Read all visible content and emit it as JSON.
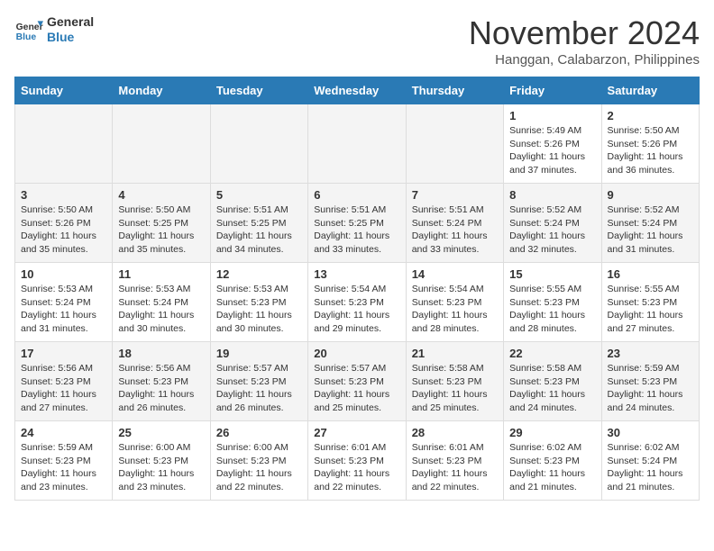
{
  "header": {
    "logo_general": "General",
    "logo_blue": "Blue",
    "month_title": "November 2024",
    "location": "Hanggan, Calabarzon, Philippines"
  },
  "weekdays": [
    "Sunday",
    "Monday",
    "Tuesday",
    "Wednesday",
    "Thursday",
    "Friday",
    "Saturday"
  ],
  "weeks": [
    [
      {
        "day": "",
        "empty": true
      },
      {
        "day": "",
        "empty": true
      },
      {
        "day": "",
        "empty": true
      },
      {
        "day": "",
        "empty": true
      },
      {
        "day": "",
        "empty": true
      },
      {
        "day": "1",
        "sunrise": "5:49 AM",
        "sunset": "5:26 PM",
        "daylight": "11 hours and 37 minutes."
      },
      {
        "day": "2",
        "sunrise": "5:50 AM",
        "sunset": "5:26 PM",
        "daylight": "11 hours and 36 minutes."
      }
    ],
    [
      {
        "day": "3",
        "sunrise": "5:50 AM",
        "sunset": "5:26 PM",
        "daylight": "11 hours and 35 minutes."
      },
      {
        "day": "4",
        "sunrise": "5:50 AM",
        "sunset": "5:25 PM",
        "daylight": "11 hours and 35 minutes."
      },
      {
        "day": "5",
        "sunrise": "5:51 AM",
        "sunset": "5:25 PM",
        "daylight": "11 hours and 34 minutes."
      },
      {
        "day": "6",
        "sunrise": "5:51 AM",
        "sunset": "5:25 PM",
        "daylight": "11 hours and 33 minutes."
      },
      {
        "day": "7",
        "sunrise": "5:51 AM",
        "sunset": "5:24 PM",
        "daylight": "11 hours and 33 minutes."
      },
      {
        "day": "8",
        "sunrise": "5:52 AM",
        "sunset": "5:24 PM",
        "daylight": "11 hours and 32 minutes."
      },
      {
        "day": "9",
        "sunrise": "5:52 AM",
        "sunset": "5:24 PM",
        "daylight": "11 hours and 31 minutes."
      }
    ],
    [
      {
        "day": "10",
        "sunrise": "5:53 AM",
        "sunset": "5:24 PM",
        "daylight": "11 hours and 31 minutes."
      },
      {
        "day": "11",
        "sunrise": "5:53 AM",
        "sunset": "5:24 PM",
        "daylight": "11 hours and 30 minutes."
      },
      {
        "day": "12",
        "sunrise": "5:53 AM",
        "sunset": "5:23 PM",
        "daylight": "11 hours and 30 minutes."
      },
      {
        "day": "13",
        "sunrise": "5:54 AM",
        "sunset": "5:23 PM",
        "daylight": "11 hours and 29 minutes."
      },
      {
        "day": "14",
        "sunrise": "5:54 AM",
        "sunset": "5:23 PM",
        "daylight": "11 hours and 28 minutes."
      },
      {
        "day": "15",
        "sunrise": "5:55 AM",
        "sunset": "5:23 PM",
        "daylight": "11 hours and 28 minutes."
      },
      {
        "day": "16",
        "sunrise": "5:55 AM",
        "sunset": "5:23 PM",
        "daylight": "11 hours and 27 minutes."
      }
    ],
    [
      {
        "day": "17",
        "sunrise": "5:56 AM",
        "sunset": "5:23 PM",
        "daylight": "11 hours and 27 minutes."
      },
      {
        "day": "18",
        "sunrise": "5:56 AM",
        "sunset": "5:23 PM",
        "daylight": "11 hours and 26 minutes."
      },
      {
        "day": "19",
        "sunrise": "5:57 AM",
        "sunset": "5:23 PM",
        "daylight": "11 hours and 26 minutes."
      },
      {
        "day": "20",
        "sunrise": "5:57 AM",
        "sunset": "5:23 PM",
        "daylight": "11 hours and 25 minutes."
      },
      {
        "day": "21",
        "sunrise": "5:58 AM",
        "sunset": "5:23 PM",
        "daylight": "11 hours and 25 minutes."
      },
      {
        "day": "22",
        "sunrise": "5:58 AM",
        "sunset": "5:23 PM",
        "daylight": "11 hours and 24 minutes."
      },
      {
        "day": "23",
        "sunrise": "5:59 AM",
        "sunset": "5:23 PM",
        "daylight": "11 hours and 24 minutes."
      }
    ],
    [
      {
        "day": "24",
        "sunrise": "5:59 AM",
        "sunset": "5:23 PM",
        "daylight": "11 hours and 23 minutes."
      },
      {
        "day": "25",
        "sunrise": "6:00 AM",
        "sunset": "5:23 PM",
        "daylight": "11 hours and 23 minutes."
      },
      {
        "day": "26",
        "sunrise": "6:00 AM",
        "sunset": "5:23 PM",
        "daylight": "11 hours and 22 minutes."
      },
      {
        "day": "27",
        "sunrise": "6:01 AM",
        "sunset": "5:23 PM",
        "daylight": "11 hours and 22 minutes."
      },
      {
        "day": "28",
        "sunrise": "6:01 AM",
        "sunset": "5:23 PM",
        "daylight": "11 hours and 22 minutes."
      },
      {
        "day": "29",
        "sunrise": "6:02 AM",
        "sunset": "5:23 PM",
        "daylight": "11 hours and 21 minutes."
      },
      {
        "day": "30",
        "sunrise": "6:02 AM",
        "sunset": "5:24 PM",
        "daylight": "11 hours and 21 minutes."
      }
    ]
  ],
  "labels": {
    "sunrise": "Sunrise:",
    "sunset": "Sunset:",
    "daylight": "Daylight:"
  }
}
